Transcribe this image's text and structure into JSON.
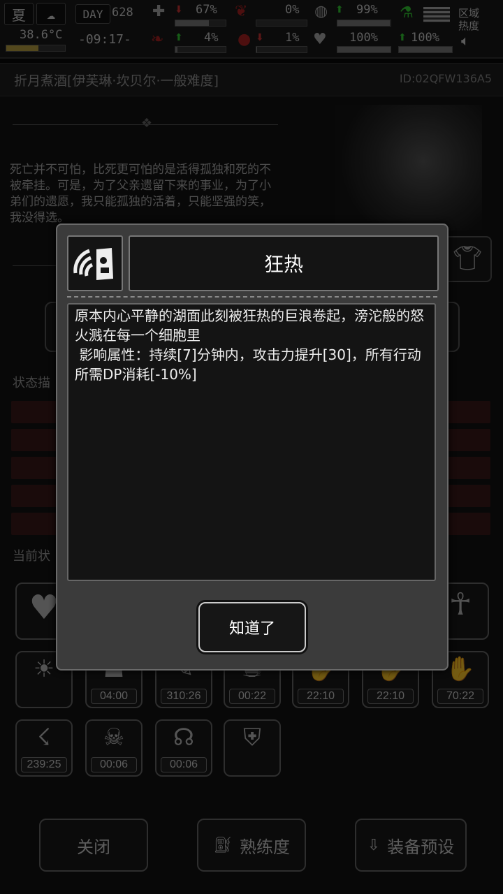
{
  "status_bar": {
    "season": "夏",
    "temperature": "38.6°C",
    "day_label": "DAY",
    "day_number": "628",
    "time": "-09:17-",
    "zone_heat_label": "区域热度",
    "stats": [
      {
        "icon": "medkit-icon",
        "value": "67%",
        "percent": 67
      },
      {
        "icon": "organ-icon",
        "value": "0%",
        "percent": 0
      },
      {
        "icon": "stomach-icon",
        "value": "99%",
        "percent": 99
      },
      {
        "icon": "lungs-icon",
        "value": "4%",
        "percent": 4
      },
      {
        "icon": "blood-drop-icon",
        "value": "1%",
        "percent": 1
      },
      {
        "icon": "heart-icon",
        "value": "100%",
        "percent": 100
      },
      {
        "icon": "flask-icon",
        "value": "100%",
        "percent": 100
      }
    ]
  },
  "header": {
    "title": "折月煮酒[伊芙琳·坎贝尔·一般难度]",
    "id": "ID:02QFW136A5"
  },
  "bio": "死亡并不可怕，比死更可怕的是活得孤独和死的不被牵挂。可是，为了父亲遗留下来的事业，为了小弟们的遗愿，我只能孤独的活着，只能坚强的笑，我没得选。",
  "sections": {
    "status_desc": "状态描",
    "current_status": "当前状"
  },
  "effects_row2": [
    "04:00",
    "310:26",
    "00:22",
    "22:10",
    "22:10",
    "70:22"
  ],
  "effects_row3": [
    "239:25",
    "00:06",
    "00:06"
  ],
  "bottom_buttons": {
    "close": "关闭",
    "proficiency": "熟练度",
    "equip_preset": "装备预设"
  },
  "modal": {
    "title": "狂热",
    "description": "原本内心平静的湖面此刻被狂热的巨浪卷起，滂沱般的怒火溅在每一个细胞里\n 影响属性：持续[7]分钟内，攻击力提升[30]，所有行动所需DP消耗[-10%]",
    "confirm": "知道了",
    "icon": "rage-icon"
  }
}
